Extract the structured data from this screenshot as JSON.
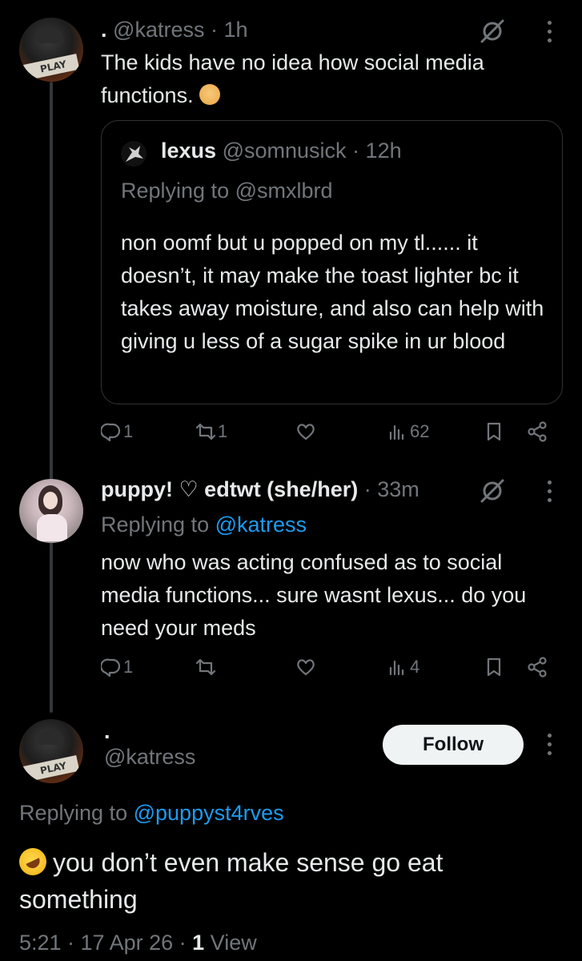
{
  "tweet1": {
    "display_name": ".",
    "handle": "@katress",
    "time": "1h",
    "text": "The kids have no idea how social media functions.",
    "quote": {
      "display_name": "lexus",
      "handle": "@somnusick",
      "time": "12h",
      "replying_label": "Replying to",
      "replying_handle": "@smxlbrd",
      "text": "non oomf but u popped on my tl...... it doesn’t, it may make the toast lighter bc it takes away moisture, and also can help with giving u less of a sugar spike in ur blood"
    },
    "actions": {
      "replies": "1",
      "reposts": "1",
      "views": "62"
    }
  },
  "tweet2": {
    "display_name": "puppy! ♡ edtwt (she/her)",
    "time": "33m",
    "replying_label": "Replying to",
    "replying_handle": "@katress",
    "text": "now who was acting confused as to social media functions... sure wasnt lexus... do you need your meds",
    "actions": {
      "replies": "1",
      "views": "4"
    }
  },
  "main": {
    "display_name": ".",
    "handle": "@katress",
    "follow_label": "Follow",
    "replying_label": "Replying to",
    "replying_handle": "@puppyst4rves",
    "text": "you don’t even make sense go eat something",
    "timestamp": "5:21 · 17 Apr 26 · ",
    "views_count": "1",
    "views_label": " View"
  },
  "colors": {
    "background": "#000000",
    "text": "#e7e9ea",
    "muted": "#71767b",
    "link": "#1d9bf0",
    "border": "#2f3336"
  }
}
